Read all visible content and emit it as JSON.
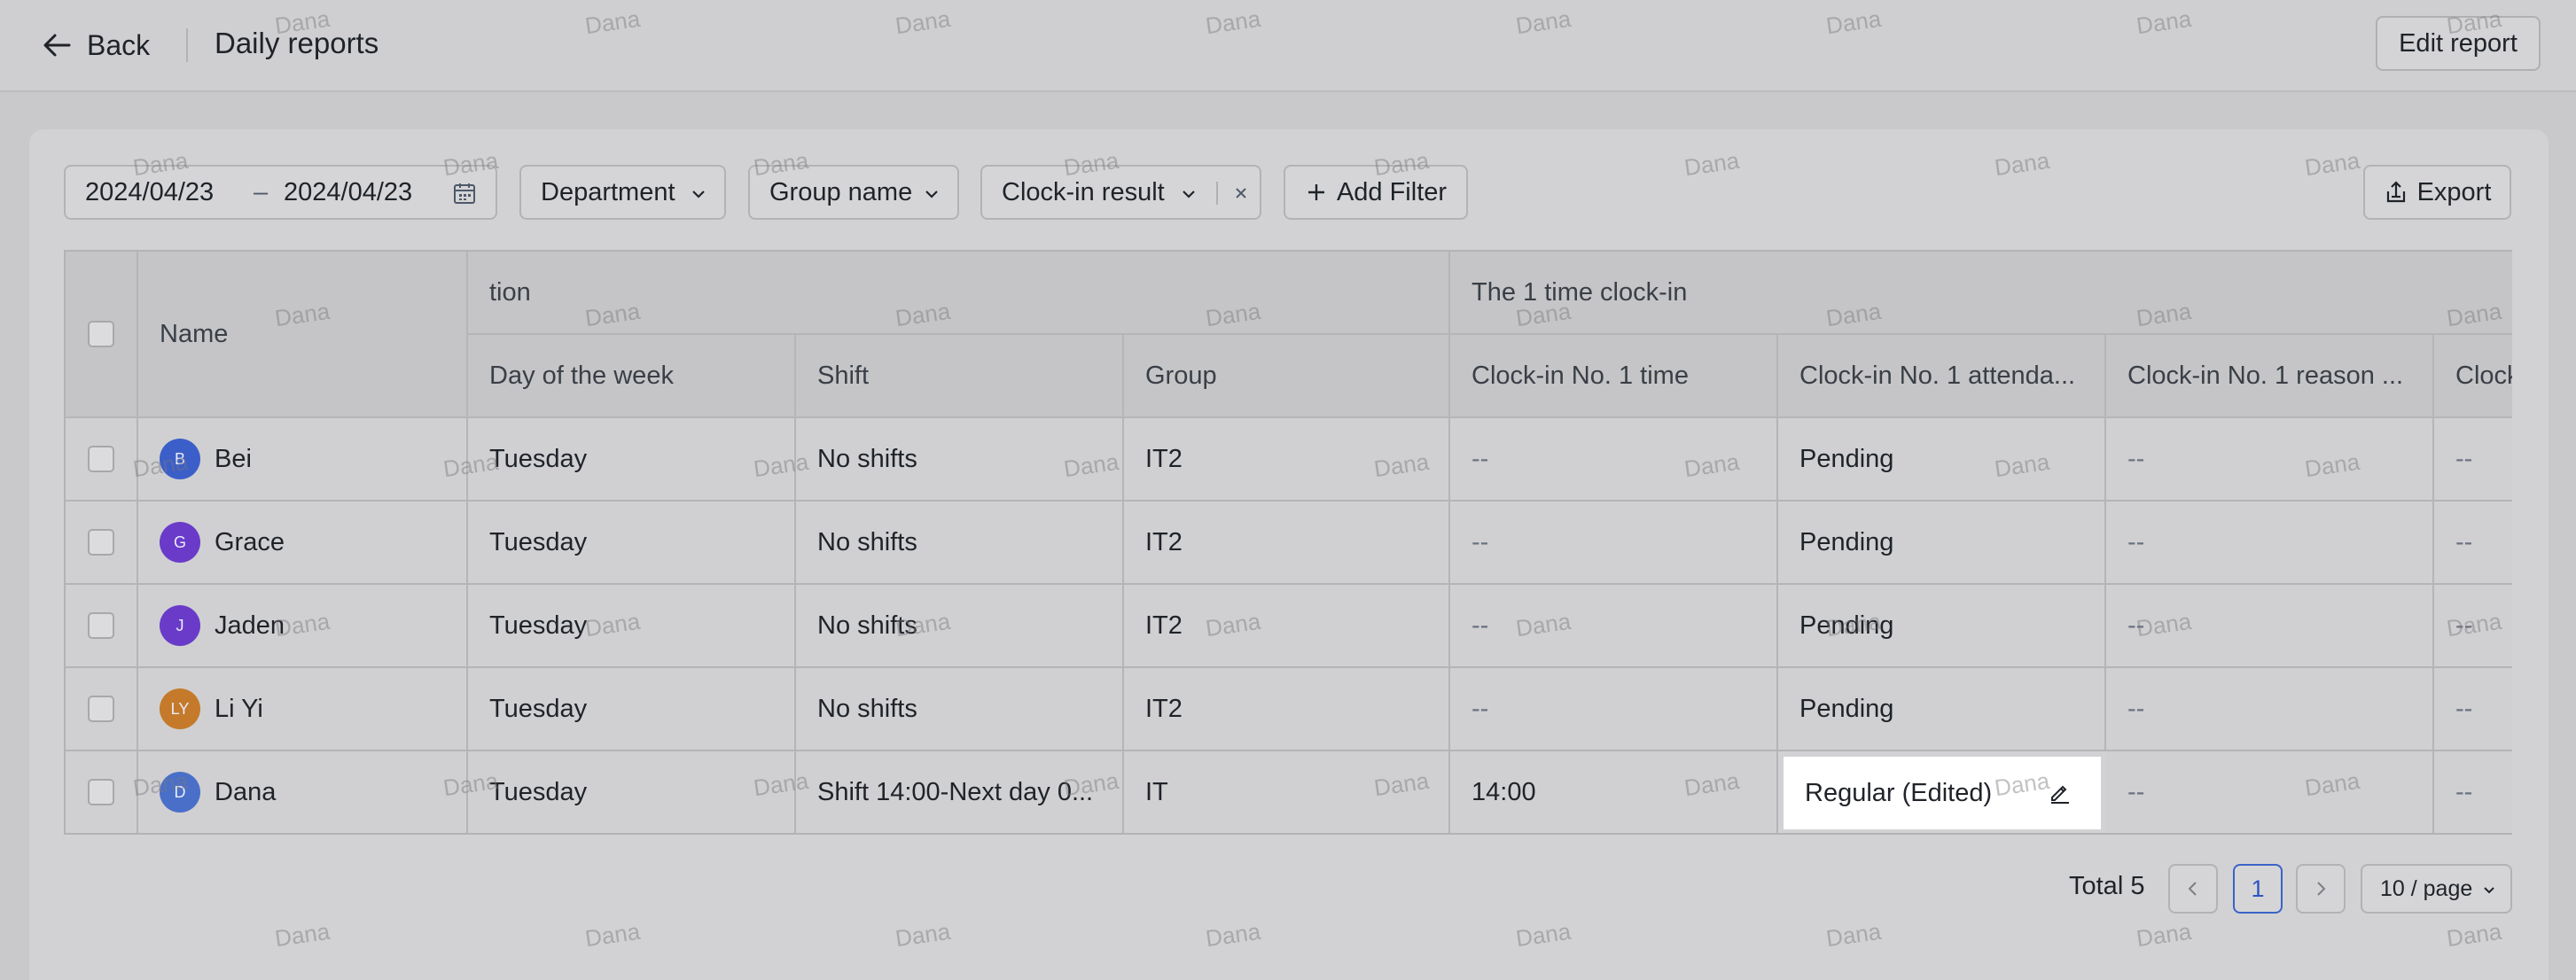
{
  "header": {
    "back_label": "Back",
    "title": "Daily reports",
    "edit_label": "Edit report"
  },
  "filters": {
    "date_start": "2024/04/23",
    "date_sep": "–",
    "date_end": "2024/04/23",
    "department": "Department",
    "group_name": "Group name",
    "clock_in_result": "Clock-in result",
    "add_filter": "Add Filter",
    "export": "Export"
  },
  "table": {
    "group_headers": {
      "basic": "tion",
      "clockin": "The 1 time clock-in"
    },
    "columns": {
      "name": "Name",
      "day": "Day of the week",
      "shift": "Shift",
      "group": "Group",
      "clock_time": "Clock-in No. 1 time",
      "attendance": "Clock-in No. 1 attenda...",
      "reason": "Clock-in No. 1 reason ...",
      "next": "Clock"
    },
    "rows": [
      {
        "initials": "B",
        "avatar_color": "#3b5ec9",
        "name": "Bei",
        "day": "Tuesday",
        "shift": "No shifts",
        "group": "IT2",
        "clock_time": "--",
        "attendance": "Pending",
        "reason": "--",
        "next": "--"
      },
      {
        "initials": "G",
        "avatar_color": "#6a3bc9",
        "name": "Grace",
        "day": "Tuesday",
        "shift": "No shifts",
        "group": "IT2",
        "clock_time": "--",
        "attendance": "Pending",
        "reason": "--",
        "next": "--"
      },
      {
        "initials": "J",
        "avatar_color": "#6a3bc9",
        "name": "Jaden",
        "day": "Tuesday",
        "shift": "No shifts",
        "group": "IT2",
        "clock_time": "--",
        "attendance": "Pending",
        "reason": "--",
        "next": "--"
      },
      {
        "initials": "LY",
        "avatar_color": "#c47a2a",
        "name": "Li Yi",
        "day": "Tuesday",
        "shift": "No shifts",
        "group": "IT2",
        "clock_time": "--",
        "attendance": "Pending",
        "reason": "--",
        "next": "--"
      },
      {
        "initials": "D",
        "avatar_color": "#4a6fc9",
        "name": "Dana",
        "day": "Tuesday",
        "shift": "Shift 14:00-Next day 0...",
        "group": "IT",
        "clock_time": "14:00",
        "attendance": "Regular (Edited)",
        "reason": "--",
        "next": "--"
      }
    ]
  },
  "pagination": {
    "total_label": "Total 5",
    "current_page": "1",
    "page_size": "10 / page"
  },
  "watermark": "Dana"
}
